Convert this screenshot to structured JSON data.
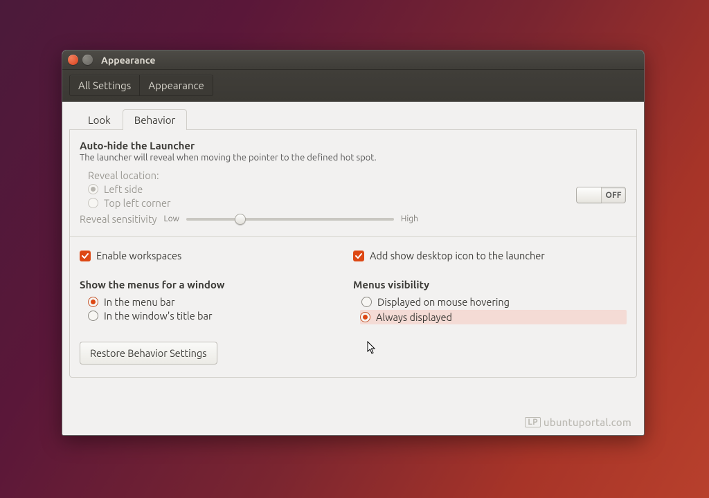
{
  "window": {
    "title": "Appearance"
  },
  "breadcrumb": {
    "all_settings": "All Settings",
    "appearance": "Appearance"
  },
  "tabs": {
    "look": "Look",
    "behavior": "Behavior"
  },
  "autohide": {
    "title": "Auto-hide the Launcher",
    "desc": "The launcher will reveal when moving the pointer to the defined hot spot.",
    "switch_label": "OFF",
    "reveal_location_label": "Reveal location:",
    "opt_left": "Left side",
    "opt_topleft": "Top left corner",
    "sensitivity_label": "Reveal sensitivity",
    "low": "Low",
    "high": "High"
  },
  "checks": {
    "workspaces": "Enable workspaces",
    "show_desktop": "Add show desktop icon to the launcher"
  },
  "menus": {
    "show_title": "Show the menus for a window",
    "opt_menubar": "In the menu bar",
    "opt_titlebar": "In the window's title bar",
    "visibility_title": "Menus visibility",
    "opt_hover": "Displayed on mouse hovering",
    "opt_always": "Always displayed"
  },
  "restore_label": "Restore Behavior Settings",
  "watermark": "ubuntuportal.com"
}
